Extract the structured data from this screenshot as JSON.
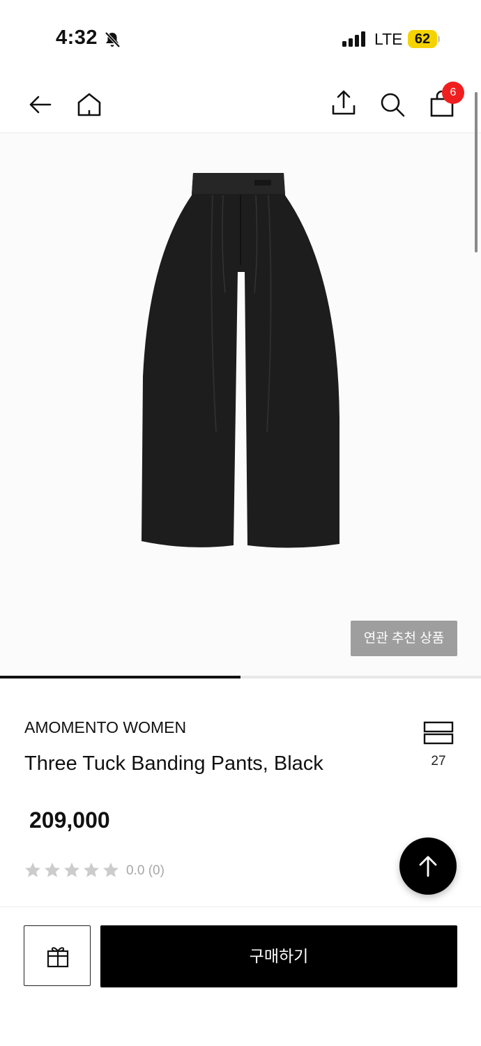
{
  "status_bar": {
    "time": "4:32",
    "network": "LTE",
    "battery": "62",
    "icons": [
      "bell-slash-icon",
      "signal-bars-icon",
      "battery-icon"
    ]
  },
  "nav": {
    "icons": [
      "back-arrow-icon",
      "home-icon",
      "share-icon",
      "search-icon",
      "shopping-bag-icon"
    ],
    "cart_badge": "6"
  },
  "product_image": {
    "related_button": "연관 추천 상품",
    "image_progress": 0.5
  },
  "product": {
    "brand": "AMOMENTO WOMEN",
    "name": "Three Tuck Banding Pants, Black",
    "price": "209,000",
    "rating_text": "0.0 (0)",
    "rating_stars_filled": 0,
    "rating_stars_total": 5,
    "list_count": "27"
  },
  "bottom_bar": {
    "buy_label": "구매하기",
    "icons": [
      "gift-icon",
      "arrow-up-icon"
    ]
  },
  "colors": {
    "badge": "#f01f1f",
    "battery": "#f5d300",
    "related_button": "#9e9e9e",
    "buy_button": "#000000",
    "star_empty": "#cccccc"
  }
}
